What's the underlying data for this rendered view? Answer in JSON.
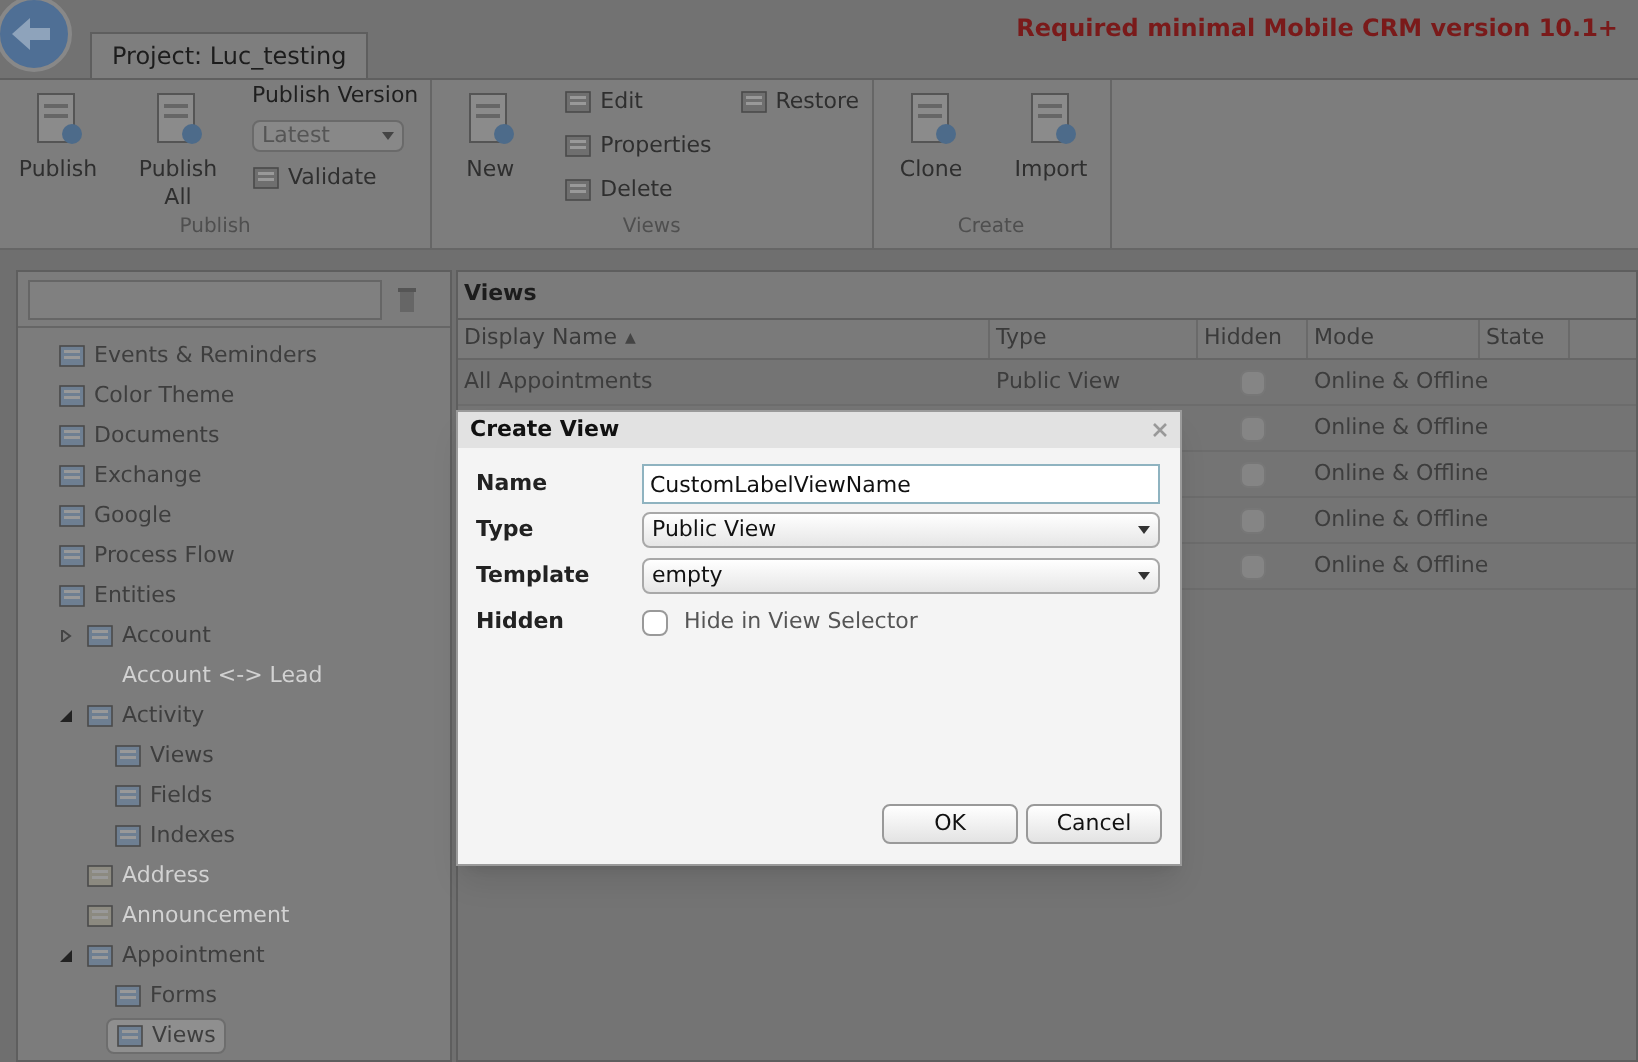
{
  "tab": {
    "label": "Project: Luc_testing"
  },
  "notice": "Required minimal Mobile CRM version 10.1+",
  "ribbon": {
    "groups": [
      {
        "label": "Publish",
        "columns": [
          [
            {
              "kind": "large",
              "label": "Publish"
            }
          ],
          [
            {
              "kind": "large",
              "label": "Publish All"
            }
          ],
          [
            {
              "kind": "caption",
              "label": "Publish Version"
            },
            {
              "kind": "dropdown",
              "label": "Latest"
            },
            {
              "kind": "small",
              "label": "Validate"
            }
          ]
        ]
      },
      {
        "label": "Views",
        "columns": [
          [
            {
              "kind": "large",
              "label": "New"
            }
          ],
          [
            {
              "kind": "small",
              "label": "Edit"
            },
            {
              "kind": "small",
              "label": "Properties"
            },
            {
              "kind": "small",
              "label": "Delete"
            }
          ],
          [
            {
              "kind": "small",
              "label": "Restore"
            }
          ]
        ]
      },
      {
        "label": "Create",
        "columns": [
          [
            {
              "kind": "large",
              "label": "Clone"
            }
          ],
          [
            {
              "kind": "large",
              "label": "Import"
            }
          ]
        ]
      }
    ]
  },
  "sidebar": {
    "items": [
      {
        "label": "Events & Reminders",
        "kind": "node",
        "disabled": false,
        "selected": false
      },
      {
        "label": "Color Theme",
        "kind": "node",
        "disabled": false,
        "selected": false
      },
      {
        "label": "Documents",
        "kind": "node",
        "disabled": false,
        "selected": false
      },
      {
        "label": "Exchange",
        "kind": "node",
        "disabled": false,
        "selected": false
      },
      {
        "label": "Google",
        "kind": "node",
        "disabled": false,
        "selected": false
      },
      {
        "label": "Process Flow",
        "kind": "node",
        "disabled": false,
        "selected": false
      },
      {
        "label": "Entities",
        "kind": "node",
        "disabled": false,
        "selected": false,
        "children": [
          {
            "label": "Account",
            "kind": "node",
            "disabled": false,
            "selected": false,
            "expanded": false
          },
          {
            "label": "Account <-> Lead",
            "kind": "link",
            "disabled": true,
            "selected": false
          },
          {
            "label": "Activity",
            "kind": "node",
            "disabled": false,
            "selected": false,
            "expanded": true,
            "children": [
              {
                "label": "Views",
                "kind": "node",
                "disabled": false,
                "selected": false
              },
              {
                "label": "Fields",
                "kind": "node",
                "disabled": false,
                "selected": false
              },
              {
                "label": "Indexes",
                "kind": "node",
                "disabled": false,
                "selected": false
              }
            ]
          },
          {
            "label": "Address",
            "kind": "node",
            "disabled": true,
            "selected": false
          },
          {
            "label": "Announcement",
            "kind": "node",
            "disabled": true,
            "selected": false
          },
          {
            "label": "Appointment",
            "kind": "node",
            "disabled": false,
            "selected": false,
            "expanded": true,
            "children": [
              {
                "label": "Forms",
                "kind": "node",
                "disabled": false,
                "selected": false
              },
              {
                "label": "Views",
                "kind": "node",
                "disabled": false,
                "selected": true
              }
            ]
          }
        ]
      }
    ]
  },
  "views": {
    "title": "Views",
    "columns": [
      {
        "label": "Display Name",
        "sort_mark": "▲"
      },
      {
        "label": "Type"
      },
      {
        "label": "Hidden"
      },
      {
        "label": "Mode"
      },
      {
        "label": "State"
      }
    ],
    "rows": [
      {
        "display_name": "All Appointments",
        "type": "Public View",
        "hidden": false,
        "mode": "Online & Offline"
      },
      {
        "hidden": false,
        "mode": "Online & Offline"
      },
      {
        "hidden": false,
        "mode": "Online & Offline"
      },
      {
        "hidden": false,
        "mode": "Online & Offline"
      },
      {
        "hidden": false,
        "mode": "Online & Offline"
      }
    ]
  },
  "dialog": {
    "title": "Create View",
    "fields": [
      {
        "kind": "text",
        "label": "Name",
        "value": "CustomLabelViewName"
      },
      {
        "kind": "select",
        "label": "Type",
        "value": "Public View"
      },
      {
        "kind": "select",
        "label": "Template",
        "value": "empty"
      },
      {
        "kind": "checkbox",
        "label": "Hidden",
        "text": "Hide in View Selector",
        "checked": false
      }
    ],
    "buttons": [
      "OK",
      "Cancel"
    ]
  }
}
